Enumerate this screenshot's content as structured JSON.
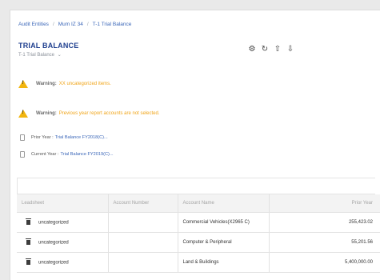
{
  "breadcrumb": {
    "items": [
      "Audit Entities",
      "Mum IZ 34",
      "T-1 Trial Balance"
    ],
    "separator": "/"
  },
  "page": {
    "title": "TRIAL BALANCE",
    "subtitle": "T-1 Trial Balance",
    "subtitle_icon": "chevron-down-icon"
  },
  "toolbar": {
    "icons": [
      "gear-icon",
      "refresh-icon",
      "upload-icon",
      "download-icon"
    ]
  },
  "warnings": [
    {
      "label": "Warning:",
      "text": "XX uncategorized items."
    },
    {
      "label": "Warning:",
      "text": "Previous year report accounts are not selected."
    }
  ],
  "files": {
    "prior": {
      "label": "Prior Year :",
      "value": "Trial Balance FY2018(C)..."
    },
    "current": {
      "label": "Current Year :",
      "value": "Trial Balance FY2019(C)..."
    }
  },
  "table": {
    "headers": [
      "Leadsheet",
      "Account Number",
      "Account Name",
      "Prior Year"
    ],
    "rows": [
      {
        "leadsheet": "uncategorized",
        "account_number": "",
        "account_name": "Commercial Vehicles(X2965 C)",
        "prior_year": "255,423.02"
      },
      {
        "leadsheet": "uncategorized",
        "account_number": "",
        "account_name": "Computer & Peripheral",
        "prior_year": "55,201.56"
      },
      {
        "leadsheet": "uncategorized",
        "account_number": "",
        "account_name": "Land & Buildings",
        "prior_year": "5,400,000.00"
      }
    ]
  },
  "colors": {
    "link": "#3a66b8",
    "title": "#1f3f8f",
    "warning_text": "#f0a417",
    "warning_icon": "#f2b50f"
  }
}
